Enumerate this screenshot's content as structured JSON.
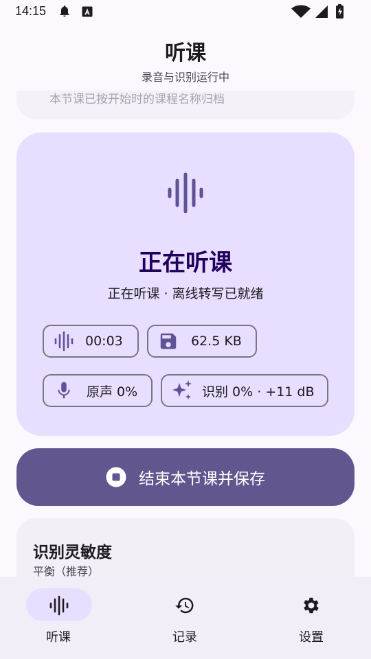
{
  "status_bar": {
    "time": "14:15",
    "icons": [
      "bell-icon",
      "a-icon",
      "wifi-icon",
      "signal-icon",
      "battery-charging-icon"
    ]
  },
  "header": {
    "title": "听课",
    "subtitle": "录音与识别运行中"
  },
  "previous_card": {
    "text": "本节课已按开始时的课程名称归档"
  },
  "listening_card": {
    "icon": "waveform-icon",
    "title": "正在听课",
    "subtitle": "正在听课 · 离线转写已就绪",
    "chips": {
      "duration": "00:03",
      "size": "62.5 KB",
      "raw_level": "原声 0%",
      "recognition": "识别 0% · +11 dB"
    }
  },
  "stop_button": {
    "label": "结束本节课并保存",
    "icon": "stop-circle-icon"
  },
  "sensitivity": {
    "title": "识别灵敏度",
    "value": "平衡（推荐）"
  },
  "bottom_nav": {
    "items": [
      {
        "label": "听课",
        "icon": "waveform-icon",
        "active": true
      },
      {
        "label": "记录",
        "icon": "history-icon",
        "active": false
      },
      {
        "label": "设置",
        "icon": "gear-icon",
        "active": false
      }
    ]
  },
  "colors": {
    "background": "#FDF8FD",
    "card": "#E8DEFF",
    "accent": "#63568F",
    "icon": "#5F5296",
    "title": "#21005D"
  }
}
